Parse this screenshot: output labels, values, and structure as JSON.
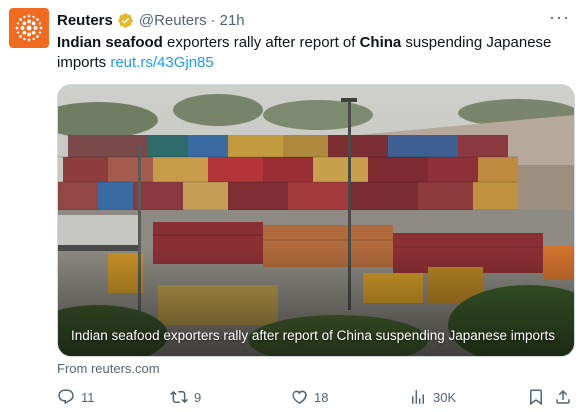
{
  "tweet": {
    "display_name": "Reuters",
    "handle": "@Reuters",
    "separator": "·",
    "time": "21h",
    "more_label": "···",
    "text": {
      "bold_1": "Indian seafood",
      "part_1": " exporters rally after report of ",
      "bold_2": "China",
      "part_2": " suspending Japanese imports ",
      "link": "reut.rs/43Gjn85"
    },
    "card": {
      "caption": "Indian seafood exporters rally after report of China suspending Japanese imports",
      "source": "From reuters.com"
    },
    "actions": {
      "replies": "11",
      "reposts": "9",
      "likes": "18",
      "views": "30K"
    }
  },
  "colors": {
    "avatar": "#f06a1f",
    "verified": "#e8b829",
    "link": "#1d9bf0",
    "secondary_text": "#536471"
  }
}
